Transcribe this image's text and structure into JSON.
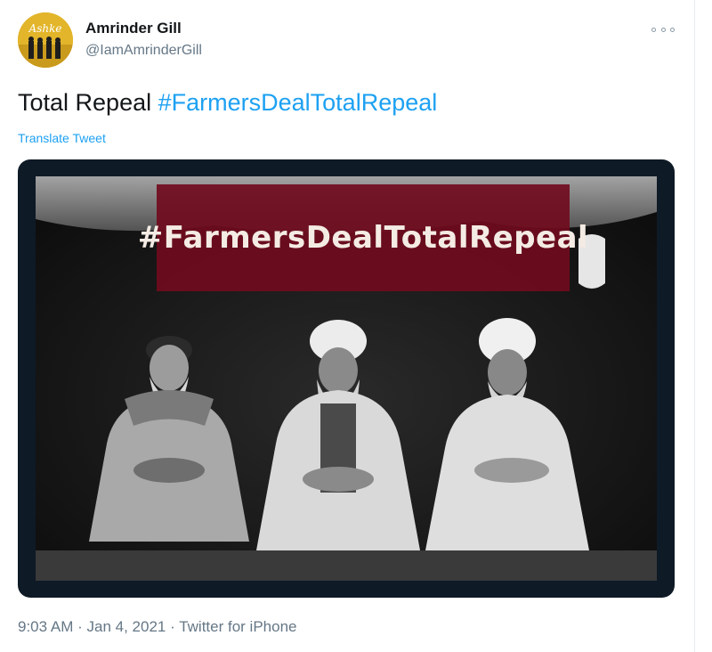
{
  "author": {
    "display_name": "Amrinder Gill",
    "handle": "@IamAmrinderGill",
    "avatar_text": "Ashke"
  },
  "tweet": {
    "text_plain": "Total Repeal",
    "hashtag": "#FarmersDealTotalRepeal",
    "translate_label": "Translate Tweet"
  },
  "media": {
    "banner_text": "#FarmersDealTotalRepeal"
  },
  "meta": {
    "time": "9:03 AM",
    "date": "Jan 4, 2021",
    "source": "Twitter for iPhone",
    "separator": "·"
  }
}
